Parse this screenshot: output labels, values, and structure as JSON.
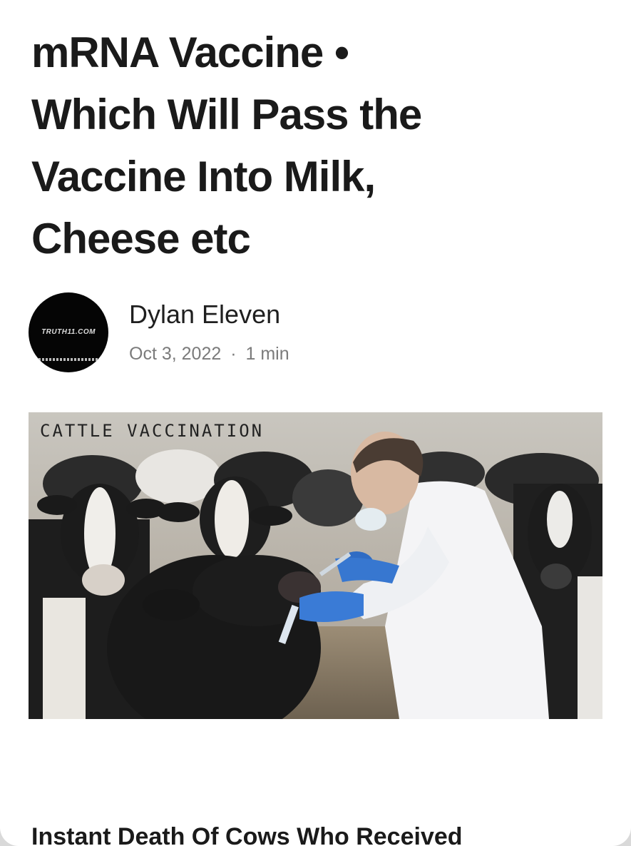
{
  "article": {
    "title_lines": [
      "mRNA Vaccine •",
      "Which Will Pass the",
      "Vaccine Into Milk,",
      "Cheese etc"
    ],
    "author": {
      "name": "Dylan Eleven",
      "avatar_text": "TRUTH11.COM",
      "avatar_icon": "truth11-logo-icon"
    },
    "date": "Oct 3, 2022",
    "separator": "·",
    "read_time": "1 min",
    "hero_image": {
      "caption": "CATTLE VACCINATION",
      "depicts": "cattle-vaccination-photo"
    },
    "next_heading": "Instant Death Of Cows Who Received"
  },
  "colors": {
    "background": "#ffffff",
    "text": "#1a1a1a",
    "meta": "#7b7b7b",
    "outer": "#d9d9d9"
  }
}
